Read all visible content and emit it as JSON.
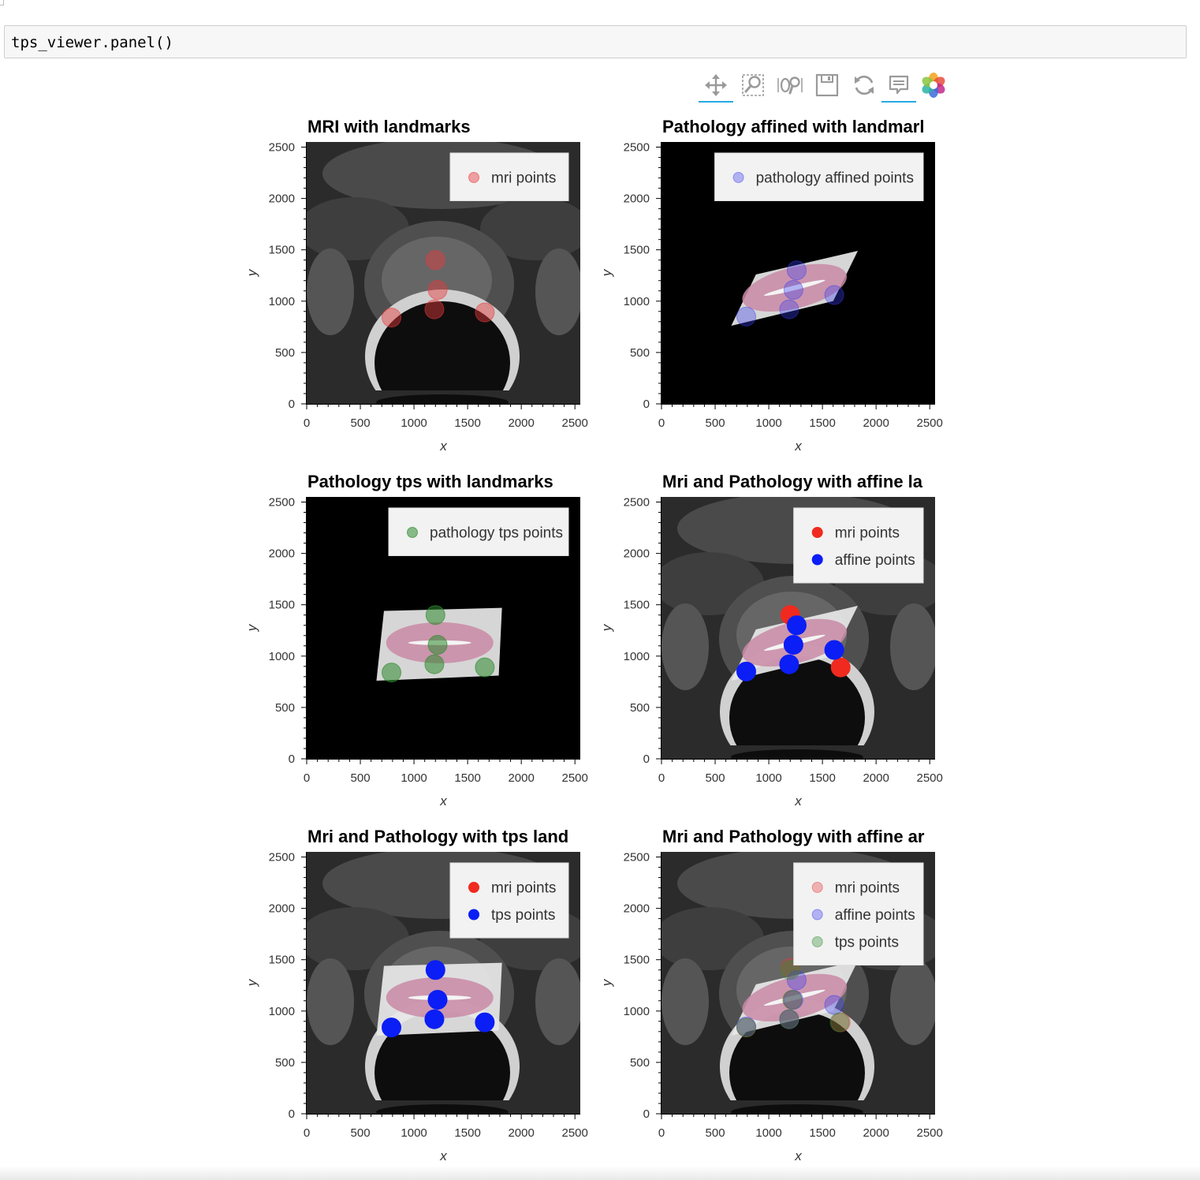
{
  "notebook": {
    "cell_code": "tps_viewer.panel()"
  },
  "toolbar": {
    "tools": [
      {
        "name": "pan",
        "icon": "pan-icon",
        "active": true
      },
      {
        "name": "box-zoom",
        "icon": "box-zoom-icon",
        "active": false
      },
      {
        "name": "wheel-zoom",
        "icon": "wheel-zoom-icon",
        "active": false
      },
      {
        "name": "save",
        "icon": "save-icon",
        "active": false
      },
      {
        "name": "reset",
        "icon": "reset-icon",
        "active": false
      },
      {
        "name": "hover",
        "icon": "hover-icon",
        "active": true
      },
      {
        "name": "bokeh-logo",
        "icon": "bokeh-logo-icon",
        "active": false
      }
    ]
  },
  "chart_data": [
    {
      "type": "scatter",
      "title": "MRI with landmarks",
      "xlabel": "x",
      "ylabel": "y",
      "xlim": [
        0,
        2550
      ],
      "ylim": [
        0,
        2550
      ],
      "xticks": [
        0,
        500,
        1000,
        1500,
        2000,
        2500
      ],
      "yticks": [
        0,
        500,
        1000,
        1500,
        2000,
        2500
      ],
      "background": "mri",
      "legend_position": "top-right",
      "series": [
        {
          "name": "mri points",
          "color": "#e8393c",
          "alpha": 0.45,
          "x": [
            1200,
            1220,
            1190,
            790,
            1660
          ],
          "y": [
            1400,
            1110,
            920,
            840,
            890
          ]
        }
      ]
    },
    {
      "type": "scatter",
      "title": "Pathology affined with landmarl",
      "xlabel": "x",
      "ylabel": "y",
      "xlim": [
        0,
        2550
      ],
      "ylim": [
        0,
        2550
      ],
      "xticks": [
        0,
        500,
        1000,
        1500,
        2000,
        2500
      ],
      "yticks": [
        0,
        500,
        1000,
        1500,
        2000,
        2500
      ],
      "background": "black",
      "tissue": "affine",
      "legend_position": "top-right",
      "series": [
        {
          "name": "pathology affined points",
          "color": "#3a3cf0",
          "alpha": 0.35,
          "x": [
            1260,
            1230,
            1190,
            790,
            1610
          ],
          "y": [
            1300,
            1110,
            920,
            850,
            1060
          ]
        }
      ]
    },
    {
      "type": "scatter",
      "title": "Pathology tps with landmarks",
      "xlabel": "x",
      "ylabel": "y",
      "xlim": [
        0,
        2550
      ],
      "ylim": [
        0,
        2550
      ],
      "xticks": [
        0,
        500,
        1000,
        1500,
        2000,
        2500
      ],
      "yticks": [
        0,
        500,
        1000,
        1500,
        2000,
        2500
      ],
      "background": "black",
      "tissue": "tps",
      "legend_position": "top-right",
      "series": [
        {
          "name": "pathology tps points",
          "color": "#2e8b2e",
          "alpha": 0.55,
          "x": [
            1200,
            1220,
            1190,
            790,
            1660
          ],
          "y": [
            1400,
            1110,
            920,
            840,
            890
          ]
        }
      ]
    },
    {
      "type": "scatter",
      "title": "Mri and Pathology with affine la",
      "xlabel": "x",
      "ylabel": "y",
      "xlim": [
        0,
        2550
      ],
      "ylim": [
        0,
        2550
      ],
      "xticks": [
        0,
        500,
        1000,
        1500,
        2000,
        2500
      ],
      "yticks": [
        0,
        500,
        1000,
        1500,
        2000,
        2500
      ],
      "background": "mri",
      "tissue": "affine",
      "legend_position": "top-right",
      "series": [
        {
          "name": "mri points",
          "color": "#f02a1e",
          "alpha": 1,
          "x": [
            1200,
            1670
          ],
          "y": [
            1400,
            890
          ]
        },
        {
          "name": "affine points",
          "color": "#0b1ef5",
          "alpha": 1,
          "x": [
            1260,
            1230,
            1190,
            790,
            1610
          ],
          "y": [
            1300,
            1110,
            920,
            850,
            1060
          ]
        }
      ]
    },
    {
      "type": "scatter",
      "title": "Mri and Pathology with tps land",
      "xlabel": "x",
      "ylabel": "y",
      "xlim": [
        0,
        2550
      ],
      "ylim": [
        0,
        2550
      ],
      "xticks": [
        0,
        500,
        1000,
        1500,
        2000,
        2500
      ],
      "yticks": [
        0,
        500,
        1000,
        1500,
        2000,
        2500
      ],
      "background": "mri",
      "tissue": "tps",
      "legend_position": "top-right",
      "series": [
        {
          "name": "mri points",
          "color": "#f02a1e",
          "alpha": 1,
          "x": [],
          "y": []
        },
        {
          "name": "tps points",
          "color": "#0b1ef5",
          "alpha": 1,
          "x": [
            1200,
            1220,
            1190,
            790,
            1660
          ],
          "y": [
            1400,
            1110,
            920,
            840,
            890
          ]
        }
      ]
    },
    {
      "type": "scatter",
      "title": "Mri and Pathology with affine ar",
      "xlabel": "x",
      "ylabel": "y",
      "xlim": [
        0,
        2550
      ],
      "ylim": [
        0,
        2550
      ],
      "xticks": [
        0,
        500,
        1000,
        1500,
        2000,
        2500
      ],
      "yticks": [
        0,
        500,
        1000,
        1500,
        2000,
        2500
      ],
      "background": "mri",
      "tissue": "affine",
      "legend_position": "top-right",
      "series": [
        {
          "name": "mri points",
          "color": "#e8393c",
          "alpha": 0.35,
          "x": [
            1200,
            1220,
            1190,
            790,
            1670
          ],
          "y": [
            1420,
            1110,
            920,
            840,
            890
          ]
        },
        {
          "name": "affine points",
          "color": "#3a3cf0",
          "alpha": 0.35,
          "x": [
            1260,
            1230,
            1190,
            790,
            1610
          ],
          "y": [
            1300,
            1110,
            920,
            850,
            1060
          ]
        },
        {
          "name": "tps points",
          "color": "#2e8b2e",
          "alpha": 0.35,
          "x": [
            1200,
            1220,
            1190,
            790,
            1660
          ],
          "y": [
            1400,
            1110,
            920,
            840,
            890
          ]
        }
      ]
    }
  ]
}
